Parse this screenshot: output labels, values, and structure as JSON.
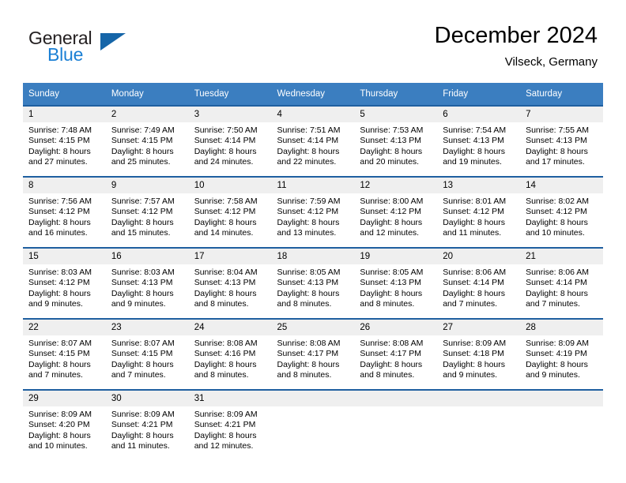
{
  "brand": {
    "name_part1": "General",
    "name_part2": "Blue",
    "triangle_color": "#1565a8",
    "blue": "#1a7fd4"
  },
  "header": {
    "title": "December 2024",
    "location": "Vilseck, Germany"
  },
  "theme": {
    "header_bg": "#3b7ec0",
    "cell_top_border": "#1f5fa0",
    "daynum_band_bg": "#efefef"
  },
  "weekday_headers": [
    "Sunday",
    "Monday",
    "Tuesday",
    "Wednesday",
    "Thursday",
    "Friday",
    "Saturday"
  ],
  "weeks": [
    [
      {
        "day": "1",
        "sunrise": "Sunrise: 7:48 AM",
        "sunset": "Sunset: 4:15 PM",
        "daylight1": "Daylight: 8 hours",
        "daylight2": "and 27 minutes."
      },
      {
        "day": "2",
        "sunrise": "Sunrise: 7:49 AM",
        "sunset": "Sunset: 4:15 PM",
        "daylight1": "Daylight: 8 hours",
        "daylight2": "and 25 minutes."
      },
      {
        "day": "3",
        "sunrise": "Sunrise: 7:50 AM",
        "sunset": "Sunset: 4:14 PM",
        "daylight1": "Daylight: 8 hours",
        "daylight2": "and 24 minutes."
      },
      {
        "day": "4",
        "sunrise": "Sunrise: 7:51 AM",
        "sunset": "Sunset: 4:14 PM",
        "daylight1": "Daylight: 8 hours",
        "daylight2": "and 22 minutes."
      },
      {
        "day": "5",
        "sunrise": "Sunrise: 7:53 AM",
        "sunset": "Sunset: 4:13 PM",
        "daylight1": "Daylight: 8 hours",
        "daylight2": "and 20 minutes."
      },
      {
        "day": "6",
        "sunrise": "Sunrise: 7:54 AM",
        "sunset": "Sunset: 4:13 PM",
        "daylight1": "Daylight: 8 hours",
        "daylight2": "and 19 minutes."
      },
      {
        "day": "7",
        "sunrise": "Sunrise: 7:55 AM",
        "sunset": "Sunset: 4:13 PM",
        "daylight1": "Daylight: 8 hours",
        "daylight2": "and 17 minutes."
      }
    ],
    [
      {
        "day": "8",
        "sunrise": "Sunrise: 7:56 AM",
        "sunset": "Sunset: 4:12 PM",
        "daylight1": "Daylight: 8 hours",
        "daylight2": "and 16 minutes."
      },
      {
        "day": "9",
        "sunrise": "Sunrise: 7:57 AM",
        "sunset": "Sunset: 4:12 PM",
        "daylight1": "Daylight: 8 hours",
        "daylight2": "and 15 minutes."
      },
      {
        "day": "10",
        "sunrise": "Sunrise: 7:58 AM",
        "sunset": "Sunset: 4:12 PM",
        "daylight1": "Daylight: 8 hours",
        "daylight2": "and 14 minutes."
      },
      {
        "day": "11",
        "sunrise": "Sunrise: 7:59 AM",
        "sunset": "Sunset: 4:12 PM",
        "daylight1": "Daylight: 8 hours",
        "daylight2": "and 13 minutes."
      },
      {
        "day": "12",
        "sunrise": "Sunrise: 8:00 AM",
        "sunset": "Sunset: 4:12 PM",
        "daylight1": "Daylight: 8 hours",
        "daylight2": "and 12 minutes."
      },
      {
        "day": "13",
        "sunrise": "Sunrise: 8:01 AM",
        "sunset": "Sunset: 4:12 PM",
        "daylight1": "Daylight: 8 hours",
        "daylight2": "and 11 minutes."
      },
      {
        "day": "14",
        "sunrise": "Sunrise: 8:02 AM",
        "sunset": "Sunset: 4:12 PM",
        "daylight1": "Daylight: 8 hours",
        "daylight2": "and 10 minutes."
      }
    ],
    [
      {
        "day": "15",
        "sunrise": "Sunrise: 8:03 AM",
        "sunset": "Sunset: 4:12 PM",
        "daylight1": "Daylight: 8 hours",
        "daylight2": "and 9 minutes."
      },
      {
        "day": "16",
        "sunrise": "Sunrise: 8:03 AM",
        "sunset": "Sunset: 4:13 PM",
        "daylight1": "Daylight: 8 hours",
        "daylight2": "and 9 minutes."
      },
      {
        "day": "17",
        "sunrise": "Sunrise: 8:04 AM",
        "sunset": "Sunset: 4:13 PM",
        "daylight1": "Daylight: 8 hours",
        "daylight2": "and 8 minutes."
      },
      {
        "day": "18",
        "sunrise": "Sunrise: 8:05 AM",
        "sunset": "Sunset: 4:13 PM",
        "daylight1": "Daylight: 8 hours",
        "daylight2": "and 8 minutes."
      },
      {
        "day": "19",
        "sunrise": "Sunrise: 8:05 AM",
        "sunset": "Sunset: 4:13 PM",
        "daylight1": "Daylight: 8 hours",
        "daylight2": "and 8 minutes."
      },
      {
        "day": "20",
        "sunrise": "Sunrise: 8:06 AM",
        "sunset": "Sunset: 4:14 PM",
        "daylight1": "Daylight: 8 hours",
        "daylight2": "and 7 minutes."
      },
      {
        "day": "21",
        "sunrise": "Sunrise: 8:06 AM",
        "sunset": "Sunset: 4:14 PM",
        "daylight1": "Daylight: 8 hours",
        "daylight2": "and 7 minutes."
      }
    ],
    [
      {
        "day": "22",
        "sunrise": "Sunrise: 8:07 AM",
        "sunset": "Sunset: 4:15 PM",
        "daylight1": "Daylight: 8 hours",
        "daylight2": "and 7 minutes."
      },
      {
        "day": "23",
        "sunrise": "Sunrise: 8:07 AM",
        "sunset": "Sunset: 4:15 PM",
        "daylight1": "Daylight: 8 hours",
        "daylight2": "and 7 minutes."
      },
      {
        "day": "24",
        "sunrise": "Sunrise: 8:08 AM",
        "sunset": "Sunset: 4:16 PM",
        "daylight1": "Daylight: 8 hours",
        "daylight2": "and 8 minutes."
      },
      {
        "day": "25",
        "sunrise": "Sunrise: 8:08 AM",
        "sunset": "Sunset: 4:17 PM",
        "daylight1": "Daylight: 8 hours",
        "daylight2": "and 8 minutes."
      },
      {
        "day": "26",
        "sunrise": "Sunrise: 8:08 AM",
        "sunset": "Sunset: 4:17 PM",
        "daylight1": "Daylight: 8 hours",
        "daylight2": "and 8 minutes."
      },
      {
        "day": "27",
        "sunrise": "Sunrise: 8:09 AM",
        "sunset": "Sunset: 4:18 PM",
        "daylight1": "Daylight: 8 hours",
        "daylight2": "and 9 minutes."
      },
      {
        "day": "28",
        "sunrise": "Sunrise: 8:09 AM",
        "sunset": "Sunset: 4:19 PM",
        "daylight1": "Daylight: 8 hours",
        "daylight2": "and 9 minutes."
      }
    ],
    [
      {
        "day": "29",
        "sunrise": "Sunrise: 8:09 AM",
        "sunset": "Sunset: 4:20 PM",
        "daylight1": "Daylight: 8 hours",
        "daylight2": "and 10 minutes."
      },
      {
        "day": "30",
        "sunrise": "Sunrise: 8:09 AM",
        "sunset": "Sunset: 4:21 PM",
        "daylight1": "Daylight: 8 hours",
        "daylight2": "and 11 minutes."
      },
      {
        "day": "31",
        "sunrise": "Sunrise: 8:09 AM",
        "sunset": "Sunset: 4:21 PM",
        "daylight1": "Daylight: 8 hours",
        "daylight2": "and 12 minutes."
      },
      {
        "day": "",
        "sunrise": "",
        "sunset": "",
        "daylight1": "",
        "daylight2": ""
      },
      {
        "day": "",
        "sunrise": "",
        "sunset": "",
        "daylight1": "",
        "daylight2": ""
      },
      {
        "day": "",
        "sunrise": "",
        "sunset": "",
        "daylight1": "",
        "daylight2": ""
      },
      {
        "day": "",
        "sunrise": "",
        "sunset": "",
        "daylight1": "",
        "daylight2": ""
      }
    ]
  ]
}
